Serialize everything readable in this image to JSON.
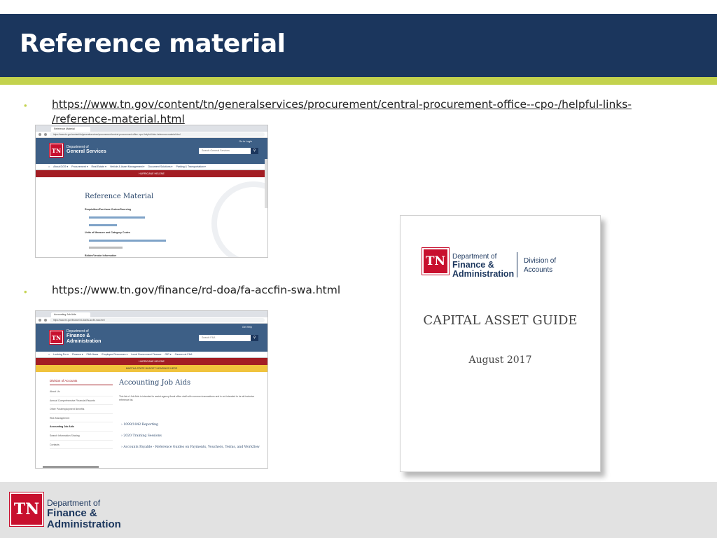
{
  "slide": {
    "title": "Reference material",
    "bullets": [
      {
        "url_line1": "https://www.tn.gov/content/tn/generalservices/procurement/central-procurement-office--cpo-/helpful-links-",
        "url_line2": "/reference-material.html"
      },
      {
        "url_line1": "https://www.tn.gov/finance/rd-doa/fa-accfin-swa.html"
      }
    ],
    "bullet_glyph": "•"
  },
  "screenshot1": {
    "tab": "Reference Material",
    "address": "https://www.tn.gov/content/tn/generalservices/procurement/central-procurement-office--cpo-/helpful-links-/reference-material.html",
    "logo": "TN",
    "dept_line1": "Department of",
    "dept_line2": "General Services",
    "login": "Go to Login",
    "search_placeholder": "Search General Services",
    "menu": [
      "About DGS ▾",
      "Procurement ▾",
      "Real Estate ▾",
      "Vehicle & Asset Management ▾",
      "Document Solutions ▾",
      "Parking & Transportation ▾"
    ],
    "alert": "HURRICANE HELENE",
    "page_title": "Reference Material",
    "headings": [
      "Requisition/Purchase Orders/Sourcing",
      "Units of Measure and Category Codes",
      "Bidder/Vendor Information"
    ]
  },
  "screenshot2": {
    "tab": "Accounting Job Aids",
    "address": "https://www.tn.gov/finance/rd-doa/fa-accfin-swa.html",
    "logo": "TN",
    "dept_line1": "Department of",
    "dept_line2": "Finance &",
    "dept_line3": "Administration",
    "login": "Get Help",
    "search_placeholder": "Search F&A",
    "menu": [
      "Looking For ▾",
      "Finance ▾",
      "F&A News",
      "Employee Resources ▾",
      "Local Government Finance",
      "OIR ▾",
      "Careers at F&A"
    ],
    "alert": "HURRICANE HELENE",
    "alert2": "MARTHA STATE BUDGET HEARINGS HERE",
    "sidebar_heading": "Division of Accounts",
    "sidebar_items": [
      "About Us",
      "Annual Comprehensive Financial Reports",
      "Other Postemployment Benefits",
      "Risk Management",
      "Accounting Job Aids",
      "Search Information Sharing",
      "Contacts"
    ],
    "page_title": "Accounting Job Aids",
    "description": "This list of Job Aids is intended to assist agency fiscal office staff with common transactions and is not intended to be all-inclusive reference list.",
    "items": [
      "1099/1042 Reporting",
      "2020 Training Sessions",
      "Accounts Payable - Reference Guides on Payments, Vouchers, Terms, and Workflow"
    ]
  },
  "document": {
    "logo": "TN",
    "dept_line1": "Department of",
    "dept_line2": "Finance &",
    "dept_line3": "Administration",
    "division_line1": "Division of",
    "division_line2": "Accounts",
    "title": "CAPITAL ASSET GUIDE",
    "date": "August 2017"
  },
  "footer": {
    "logo": "TN",
    "dept_line1": "Department of",
    "dept_line2": "Finance &",
    "dept_line3": "Administration"
  },
  "colors": {
    "header": "#1b365d",
    "accent": "#c3d24d",
    "tn_red": "#c8102e",
    "banner": "#3d5f86",
    "alert_red": "#a31d23"
  }
}
